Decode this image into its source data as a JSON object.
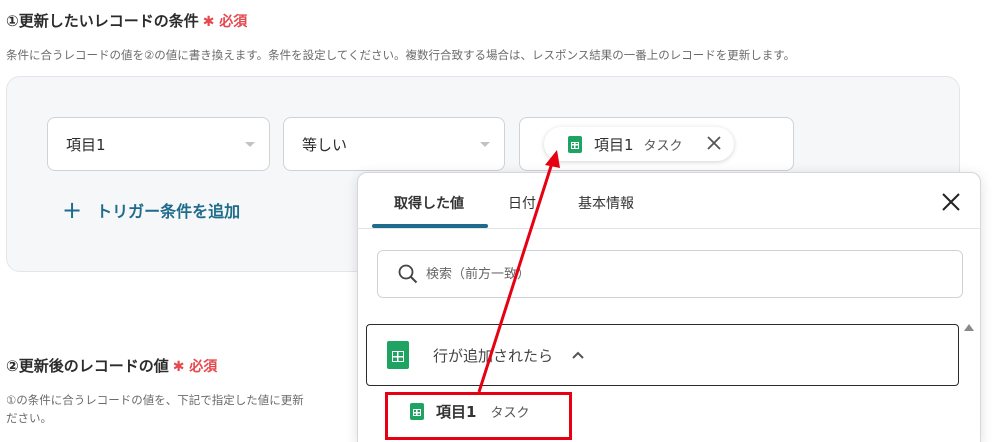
{
  "section1": {
    "title": "①更新したいレコードの条件",
    "required": "✱ 必須",
    "description": "条件に合うレコードの値を②の値に書き換えます。条件を設定してください。複数行合致する場合は、レスポンス結果の一番上のレコードを更新します。"
  },
  "condition": {
    "field_select": "項目1",
    "operator_select": "等しい",
    "value_chip": {
      "label": "項目1",
      "sub": "タスク"
    },
    "add_trigger_label": "トリガー条件を追加"
  },
  "section2": {
    "title": "②更新後のレコードの値",
    "required": "✱ 必須",
    "description_line1": "①の条件に合うレコードの値を、下記で指定した値に更新",
    "description_line2": "ださい。"
  },
  "popup": {
    "tabs": [
      {
        "label": "取得した値",
        "active": true
      },
      {
        "label": "日付",
        "active": false
      },
      {
        "label": "基本情報",
        "active": false
      }
    ],
    "search_placeholder": "検索（前方一致）",
    "group_label": "行が追加されたら",
    "item": {
      "label": "項目1",
      "sub": "タスク"
    }
  },
  "colors": {
    "accent": "#1f6b8c",
    "required": "#e5484d",
    "sheets_green": "#1ea362",
    "highlight_red": "#e60012"
  }
}
